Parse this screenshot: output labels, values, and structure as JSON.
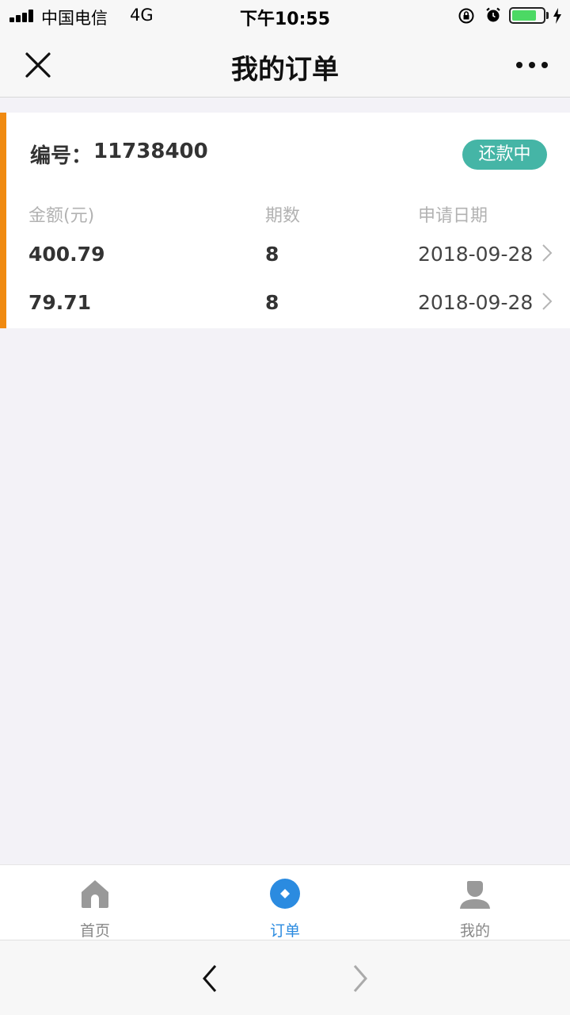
{
  "status_bar": {
    "carrier": "中国电信",
    "network": "4G",
    "time": "下午10:55",
    "battery_level": 0.8
  },
  "nav": {
    "title": "我的订单",
    "close_icon": "close-icon",
    "more_icon": "more-icon"
  },
  "order": {
    "number_label": "编号：",
    "number": "11738400",
    "status": "还款中",
    "status_color": "#45b5a6",
    "accent_color": "#f08a11",
    "columns": {
      "amount": "金额(元)",
      "periods": "期数",
      "date": "申请日期"
    },
    "rows": [
      {
        "amount": "400.79",
        "periods": "8",
        "date": "2018-09-28"
      },
      {
        "amount": "79.71",
        "periods": "8",
        "date": "2018-09-28"
      }
    ]
  },
  "tabs": [
    {
      "label": "首页",
      "icon": "home-icon",
      "active": false
    },
    {
      "label": "订单",
      "icon": "order-icon",
      "active": true,
      "color": "#2b8be0"
    },
    {
      "label": "我的",
      "icon": "user-icon",
      "active": false
    }
  ]
}
